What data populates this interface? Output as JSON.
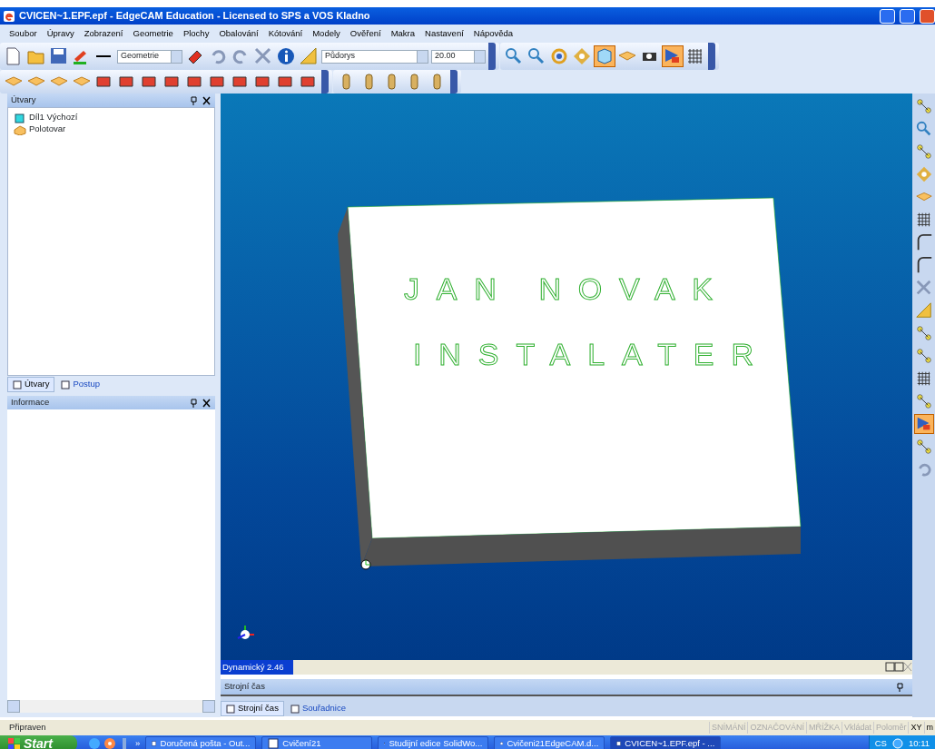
{
  "window": {
    "title": "CVICEN~1.EPF.epf - EdgeCAM Education - Licensed to SPS a VOS Kladno"
  },
  "menu": [
    "Soubor",
    "Úpravy",
    "Zobrazení",
    "Geometrie",
    "Plochy",
    "Obalování",
    "Kótování",
    "Modely",
    "Ověření",
    "Makra",
    "Nastavení",
    "Nápověda"
  ],
  "toolbar": {
    "layer": "Geometrie",
    "view": "Půdorys",
    "depth": "20.00"
  },
  "view_buttons": [
    {
      "pressed": true
    },
    {
      "pressed": false
    },
    {
      "pressed": false
    },
    {
      "pressed": true
    }
  ],
  "side_buttons": [
    {
      "pressed": false
    },
    {
      "pressed": false
    },
    {
      "pressed": false
    },
    {
      "pressed": false
    },
    {
      "pressed": false
    },
    {
      "pressed": false
    },
    {
      "pressed": false
    },
    {
      "pressed": false
    },
    {
      "pressed": false
    },
    {
      "pressed": false
    },
    {
      "pressed": false
    },
    {
      "pressed": false
    },
    {
      "pressed": false
    },
    {
      "pressed": false
    },
    {
      "pressed": true
    },
    {
      "pressed": false
    },
    {
      "pressed": false
    }
  ],
  "features_panel": {
    "title": "Útvary",
    "tree": [
      {
        "label": "Díl1 Výchozí",
        "kind": "part"
      },
      {
        "label": "Polotovar",
        "kind": "stock"
      }
    ],
    "tabs": [
      {
        "label": "Útvary",
        "selected": true
      },
      {
        "label": "Postup",
        "selected": false
      }
    ]
  },
  "info_panel": {
    "title": "Informace"
  },
  "model_text": [
    "JAN NOVAK",
    "INSTALATER"
  ],
  "viewport_status": "Dynamický 2.46",
  "machine_panel": {
    "title": "Strojní čas",
    "tabs": [
      {
        "label": "Strojní čas",
        "selected": true
      },
      {
        "label": "Souřadnice",
        "selected": false
      }
    ]
  },
  "status_bar": {
    "message": "Připraven",
    "indicators": [
      {
        "label": "SNÍMÁNÍ",
        "on": false
      },
      {
        "label": "OZNAČOVÁNÍ",
        "on": false
      },
      {
        "label": "MŘÍŽKA",
        "on": false
      },
      {
        "label": "Vkládat",
        "on": false
      },
      {
        "label": "Poloměr",
        "on": false
      },
      {
        "label": "XY",
        "on": true
      },
      {
        "label": "m",
        "on": true
      }
    ]
  },
  "taskbar": {
    "start": "Start",
    "more": "»",
    "tasks": [
      {
        "label": "Doručená pošta - Out...",
        "selected": false
      },
      {
        "label": "Cvičení21",
        "selected": false
      },
      {
        "label": "Studijní edice SolidWo...",
        "selected": false
      },
      {
        "label": "Cvičeni21EdgeCAM.d...",
        "selected": false
      },
      {
        "label": "CVICEN~1.EPF.epf - ...",
        "selected": true
      }
    ],
    "language": "CS",
    "clock": "10:11"
  }
}
